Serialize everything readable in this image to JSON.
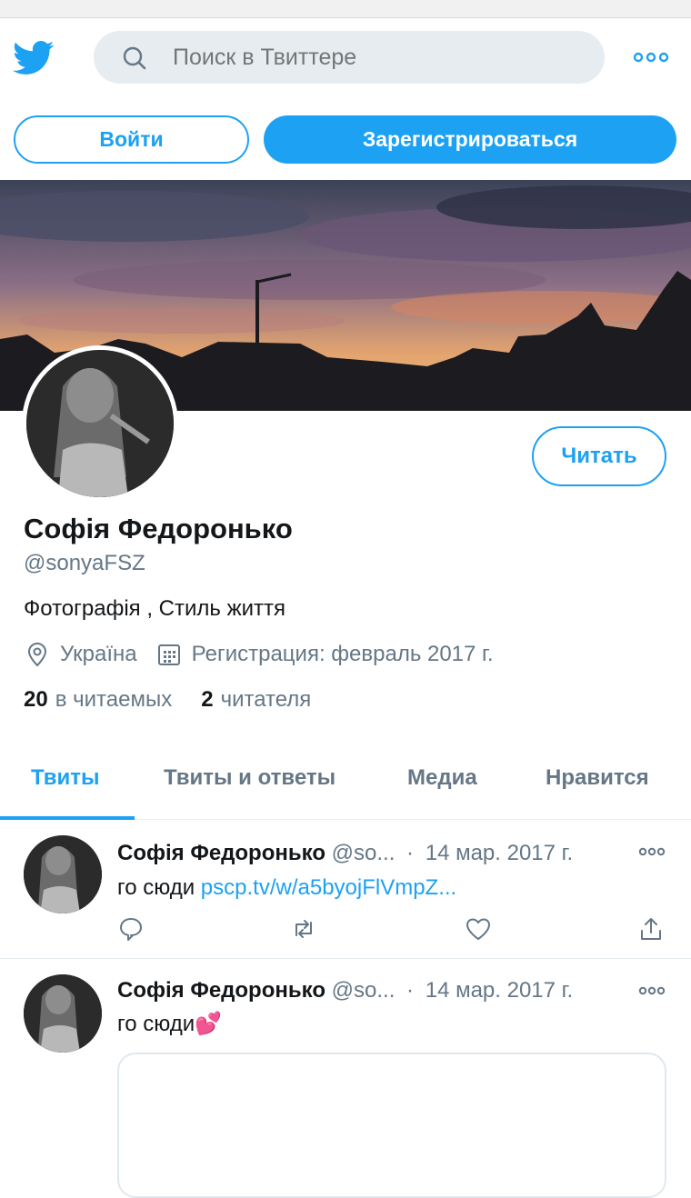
{
  "colors": {
    "accent": "#1da1f2",
    "text": "#14171a",
    "muted": "#657786",
    "search_bg": "#e6ecf0",
    "border": "#e6ecf0"
  },
  "header": {
    "logo": "twitter-bird-icon",
    "search_placeholder": "Поиск в Твиттере",
    "more_icon": "more-horizontal-icon"
  },
  "auth": {
    "login_label": "Войти",
    "signup_label": "Зарегистрироваться"
  },
  "profile": {
    "follow_label": "Читать",
    "display_name": "Софія Федоронько",
    "handle": "@sonyaFSZ",
    "bio": "Фотографія , Стиль життя",
    "location": "Україна",
    "joined": "Регистрация: февраль 2017 г.",
    "following_count": "20",
    "following_label": "в читаемых",
    "followers_count": "2",
    "followers_label": "читателя"
  },
  "tabs": [
    {
      "label": "Твиты",
      "active": true
    },
    {
      "label": "Твиты и ответы",
      "active": false
    },
    {
      "label": "Медиа",
      "active": false
    },
    {
      "label": "Нравится",
      "active": false
    }
  ],
  "tweets": [
    {
      "name": "Софія Федоронько",
      "handle": "@so...",
      "separator": "·",
      "date": "14 мар. 2017 г.",
      "text": "го сюди",
      "link": "pscp.tv/w/a5byojFlVmpZ..."
    },
    {
      "name": "Софія Федоронько",
      "handle": "@so...",
      "separator": "·",
      "date": "14 мар. 2017 г.",
      "text": "го сюди",
      "emoji": "💕"
    }
  ]
}
